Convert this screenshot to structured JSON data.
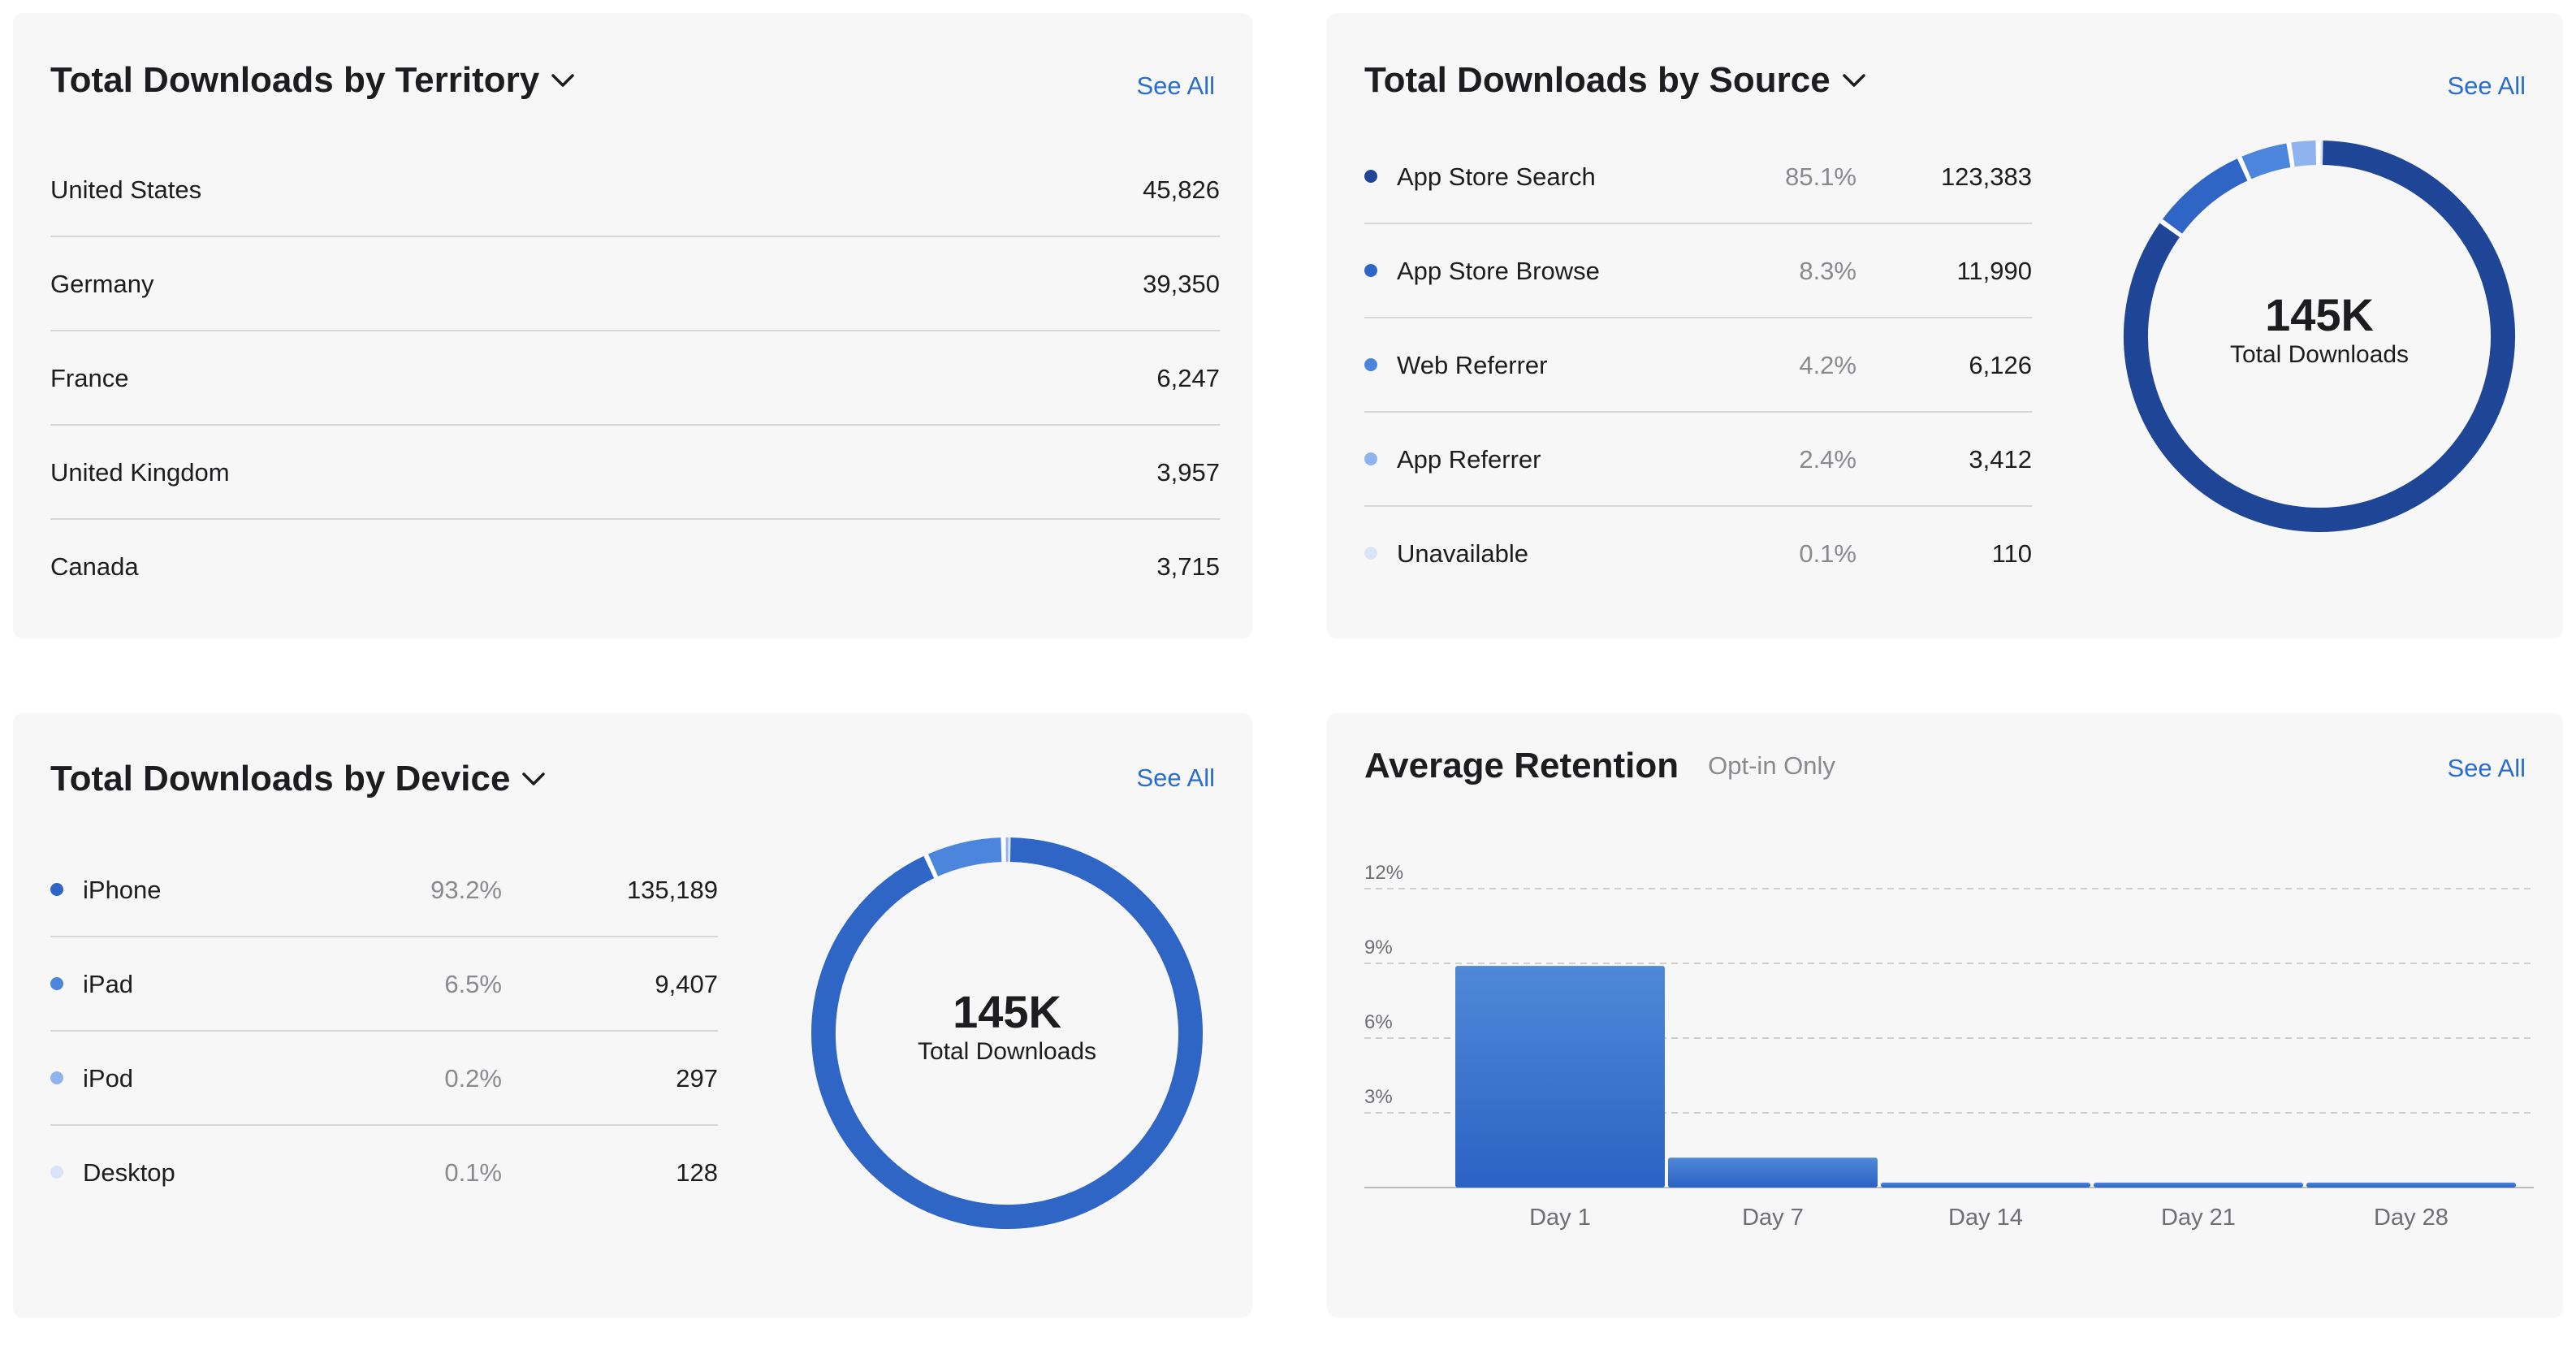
{
  "colors": {
    "accent_link": "#2a6dcc",
    "series_dark": "#1f4596",
    "series_mid": "#2f65c4",
    "series_light": "#4c86dc",
    "series_lighter": "#8fb3ee",
    "series_faint": "#d9e4f8",
    "device_main": "#2f65c4"
  },
  "territory": {
    "title": "Total Downloads by Territory",
    "see_all": "See All",
    "rows": [
      {
        "name": "United States",
        "value": "45,826"
      },
      {
        "name": "Germany",
        "value": "39,350"
      },
      {
        "name": "France",
        "value": "6,247"
      },
      {
        "name": "United Kingdom",
        "value": "3,957"
      },
      {
        "name": "Canada",
        "value": "3,715"
      }
    ]
  },
  "source": {
    "title": "Total Downloads by Source",
    "see_all": "See All",
    "rows": [
      {
        "name": "App Store Search",
        "pct": "85.1%",
        "value": "123,383"
      },
      {
        "name": "App Store Browse",
        "pct": "8.3%",
        "value": "11,990"
      },
      {
        "name": "Web Referrer",
        "pct": "4.2%",
        "value": "6,126"
      },
      {
        "name": "App Referrer",
        "pct": "2.4%",
        "value": "3,412"
      },
      {
        "name": "Unavailable",
        "pct": "0.1%",
        "value": "110"
      }
    ],
    "donut": {
      "total": "145K",
      "label": "Total Downloads"
    }
  },
  "device": {
    "title": "Total Downloads by Device",
    "see_all": "See All",
    "rows": [
      {
        "name": "iPhone",
        "pct": "93.2%",
        "value": "135,189"
      },
      {
        "name": "iPad",
        "pct": "6.5%",
        "value": "9,407"
      },
      {
        "name": "iPod",
        "pct": "0.2%",
        "value": "297"
      },
      {
        "name": "Desktop",
        "pct": "0.1%",
        "value": "128"
      }
    ],
    "donut": {
      "total": "145K",
      "label": "Total Downloads"
    }
  },
  "retention": {
    "title": "Average Retention",
    "subtitle": "Opt-in Only",
    "see_all": "See All"
  },
  "chart_data": [
    {
      "type": "pie",
      "categories": [
        "App Store Search",
        "App Store Browse",
        "Web Referrer",
        "App Referrer",
        "Unavailable"
      ],
      "values": [
        85.1,
        8.3,
        4.2,
        2.4,
        0.1
      ],
      "title": "Total Downloads by Source"
    },
    {
      "type": "pie",
      "categories": [
        "iPhone",
        "iPad",
        "iPod",
        "Desktop"
      ],
      "values": [
        93.2,
        6.5,
        0.2,
        0.1
      ],
      "title": "Total Downloads by Device"
    },
    {
      "type": "bar",
      "title": "Average Retention",
      "categories": [
        "Day 1",
        "Day 7",
        "Day 14",
        "Day 21",
        "Day 28"
      ],
      "values": [
        8.9,
        1.2,
        0.2,
        0.2,
        0.2
      ],
      "yticks": [
        "3%",
        "6%",
        "9%",
        "12%"
      ],
      "ylim": [
        0,
        12
      ],
      "grid": true
    }
  ]
}
